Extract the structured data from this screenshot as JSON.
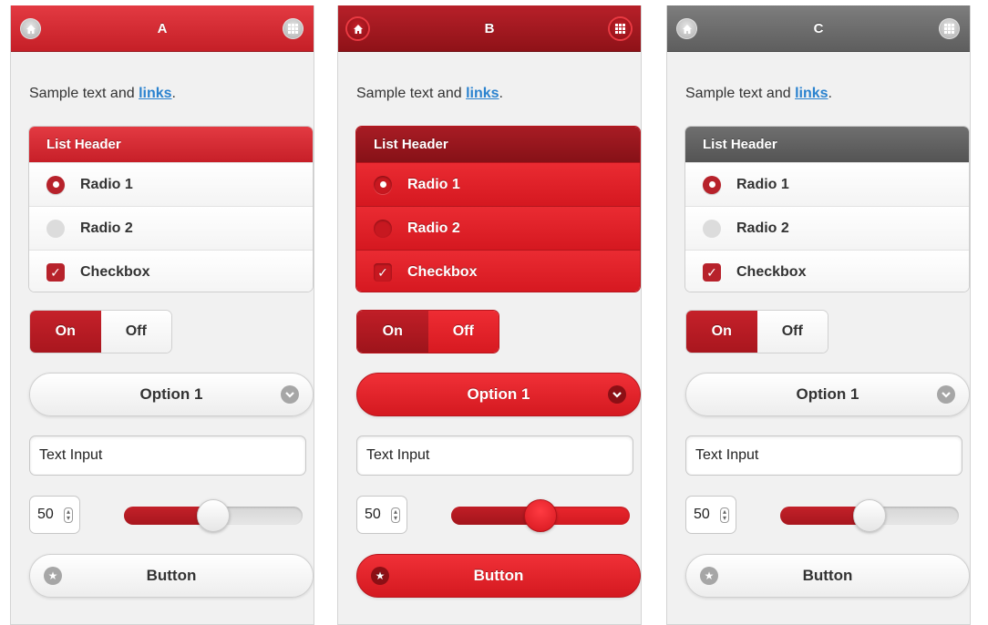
{
  "colors": {
    "accent": "#c51f27",
    "bright_red": "#e8262d",
    "dark_red": "#8f1218",
    "gray_header": "#6a6a6a",
    "link": "#2a82cf"
  },
  "panels": [
    {
      "title": "A",
      "sample_text": "Sample text and ",
      "link_text": "links",
      "sample_end": ".",
      "list_header": "List Header",
      "radio1": "Radio 1",
      "radio2": "Radio 2",
      "checkbox": "Checkbox",
      "toggle_on": "On",
      "toggle_off": "Off",
      "select_value": "Option 1",
      "text_input": "Text Input",
      "stepper_value": "50",
      "slider_value": 50,
      "button_label": "Button",
      "home_icon": "home-icon",
      "grid_icon": "grid-icon"
    },
    {
      "title": "B",
      "sample_text": "Sample text and ",
      "link_text": "links",
      "sample_end": ".",
      "list_header": "List Header",
      "radio1": "Radio 1",
      "radio2": "Radio 2",
      "checkbox": "Checkbox",
      "toggle_on": "On",
      "toggle_off": "Off",
      "select_value": "Option 1",
      "text_input": "Text Input",
      "stepper_value": "50",
      "slider_value": 50,
      "button_label": "Button",
      "home_icon": "home-icon",
      "grid_icon": "grid-icon"
    },
    {
      "title": "C",
      "sample_text": "Sample text and ",
      "link_text": "links",
      "sample_end": ".",
      "list_header": "List Header",
      "radio1": "Radio 1",
      "radio2": "Radio 2",
      "checkbox": "Checkbox",
      "toggle_on": "On",
      "toggle_off": "Off",
      "select_value": "Option 1",
      "text_input": "Text Input",
      "stepper_value": "50",
      "slider_value": 50,
      "button_label": "Button",
      "home_icon": "home-icon",
      "grid_icon": "grid-icon"
    }
  ]
}
